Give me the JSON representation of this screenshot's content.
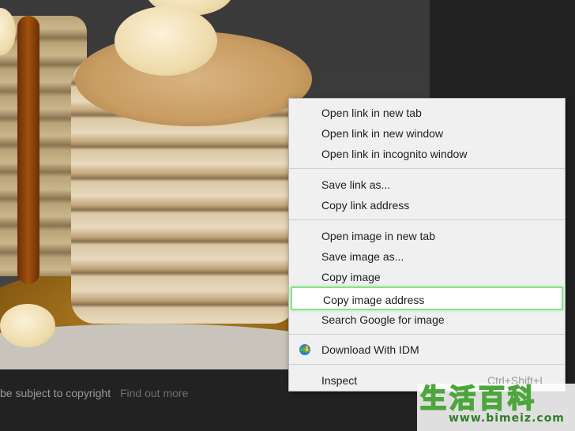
{
  "caption": {
    "copyright_text": "be subject to copyright",
    "find_out_more": "Find out more"
  },
  "context_menu": {
    "items": [
      {
        "label": "Open link in new tab"
      },
      {
        "label": "Open link in new window"
      },
      {
        "label": "Open link in incognito window"
      },
      {
        "label": "Save link as..."
      },
      {
        "label": "Copy link address"
      },
      {
        "label": "Open image in new tab"
      },
      {
        "label": "Save image as..."
      },
      {
        "label": "Copy image"
      },
      {
        "label": "Copy image address"
      },
      {
        "label": "Search Google for image"
      },
      {
        "label": "Download With IDM",
        "icon": "idm-globe-icon"
      },
      {
        "label": "Inspect",
        "shortcut": "Ctrl+Shift+I"
      }
    ],
    "highlighted_item": "Copy image address",
    "highlight_color": "#8be08f"
  },
  "watermark": {
    "chinese": "生活百科",
    "url": "www.bimeiz.com"
  }
}
